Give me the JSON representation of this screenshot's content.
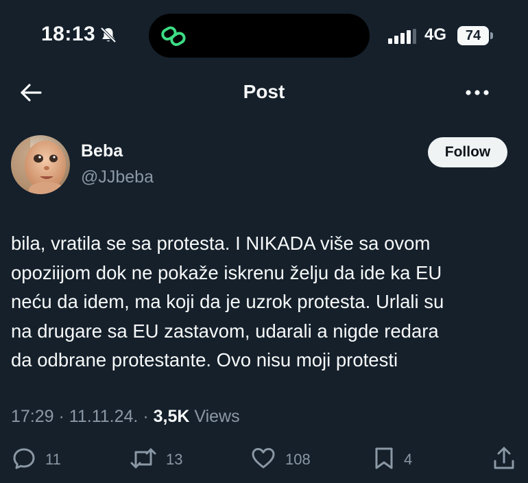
{
  "status_bar": {
    "time": "18:13",
    "network": "4G",
    "battery": "74"
  },
  "header": {
    "title": "Post"
  },
  "author": {
    "name": "Beba",
    "handle": "@JJbeba"
  },
  "follow_label": "Follow",
  "post": {
    "text": "bila, vratila se sa protesta. I NIKADA više sa ovom\nopoziijom dok ne pokaže iskrenu želju da ide ka EU\nneću da idem, ma koji da je uzrok protesta. Urlali su\nna drugare sa EU zastavom, udarali a nigde redara\nda odbrane protestante. Ovo nisu moji protesti",
    "time": "17:29",
    "date": "11.11.24.",
    "views_count": "3,5K",
    "views_label": "Views"
  },
  "actions": {
    "replies": "11",
    "reposts": "13",
    "likes": "108",
    "bookmarks": "4"
  },
  "icons": {
    "back": "arrow-left-icon",
    "more": "more-dots-icon",
    "reply": "reply-icon",
    "repost": "repost-icon",
    "like": "heart-icon",
    "bookmark": "bookmark-icon",
    "share": "share-icon"
  },
  "colors": {
    "background": "#15202b",
    "text": "#f7f9f9",
    "muted": "#8b98a5",
    "follow_bg": "#eff3f4",
    "island_icon": "#3ddc84"
  }
}
